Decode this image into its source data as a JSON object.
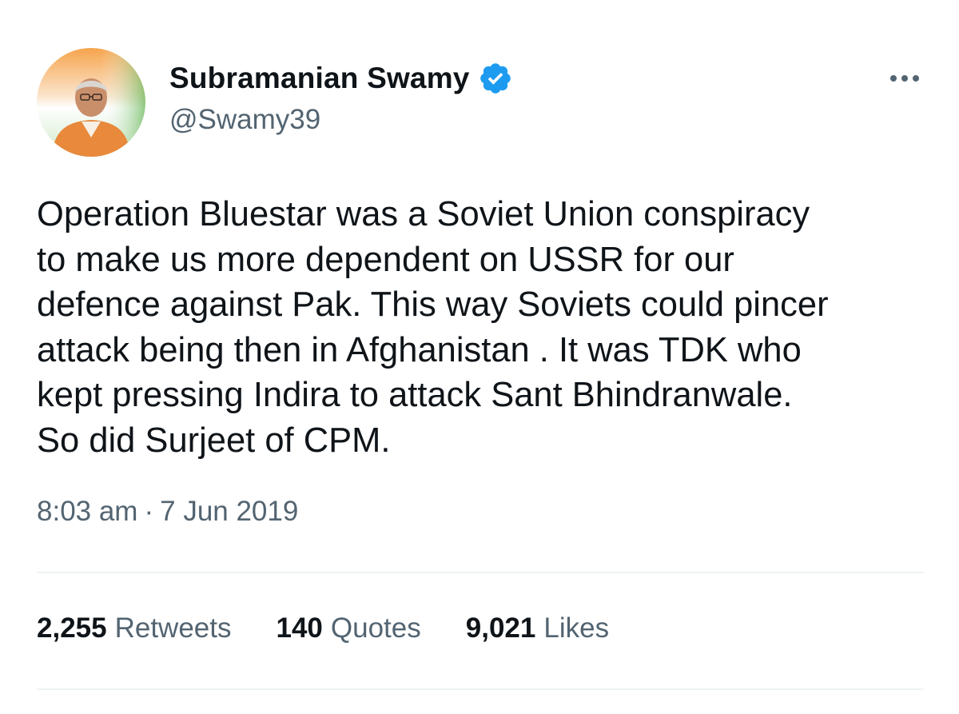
{
  "author": {
    "display_name": "Subramanian Swamy",
    "handle": "@Swamy39",
    "verified_icon": "verified-badge-icon",
    "verified_color": "#1d9bf0"
  },
  "menu": {
    "more_icon": "more-options-icon"
  },
  "tweet": {
    "text": "Operation Bluestar was a Soviet Union conspiracy\nto make us more dependent on USSR for our\ndefence against Pak. This way Soviets could pincer\nattack being then in Afghanistan . It was TDK who\nkept pressing Indira to attack Sant Bhindranwale.\nSo did Surjeet of CPM.",
    "time": "8:03 am",
    "separator": "·",
    "date": "7 Jun 2019"
  },
  "stats": {
    "retweets": {
      "count": "2,255",
      "label": "Retweets"
    },
    "quotes": {
      "count": "140",
      "label": "Quotes"
    },
    "likes": {
      "count": "9,021",
      "label": "Likes"
    }
  },
  "colors": {
    "text_primary": "#0f1419",
    "text_secondary": "#536471",
    "divider": "#eff3f4",
    "accent": "#1d9bf0"
  }
}
